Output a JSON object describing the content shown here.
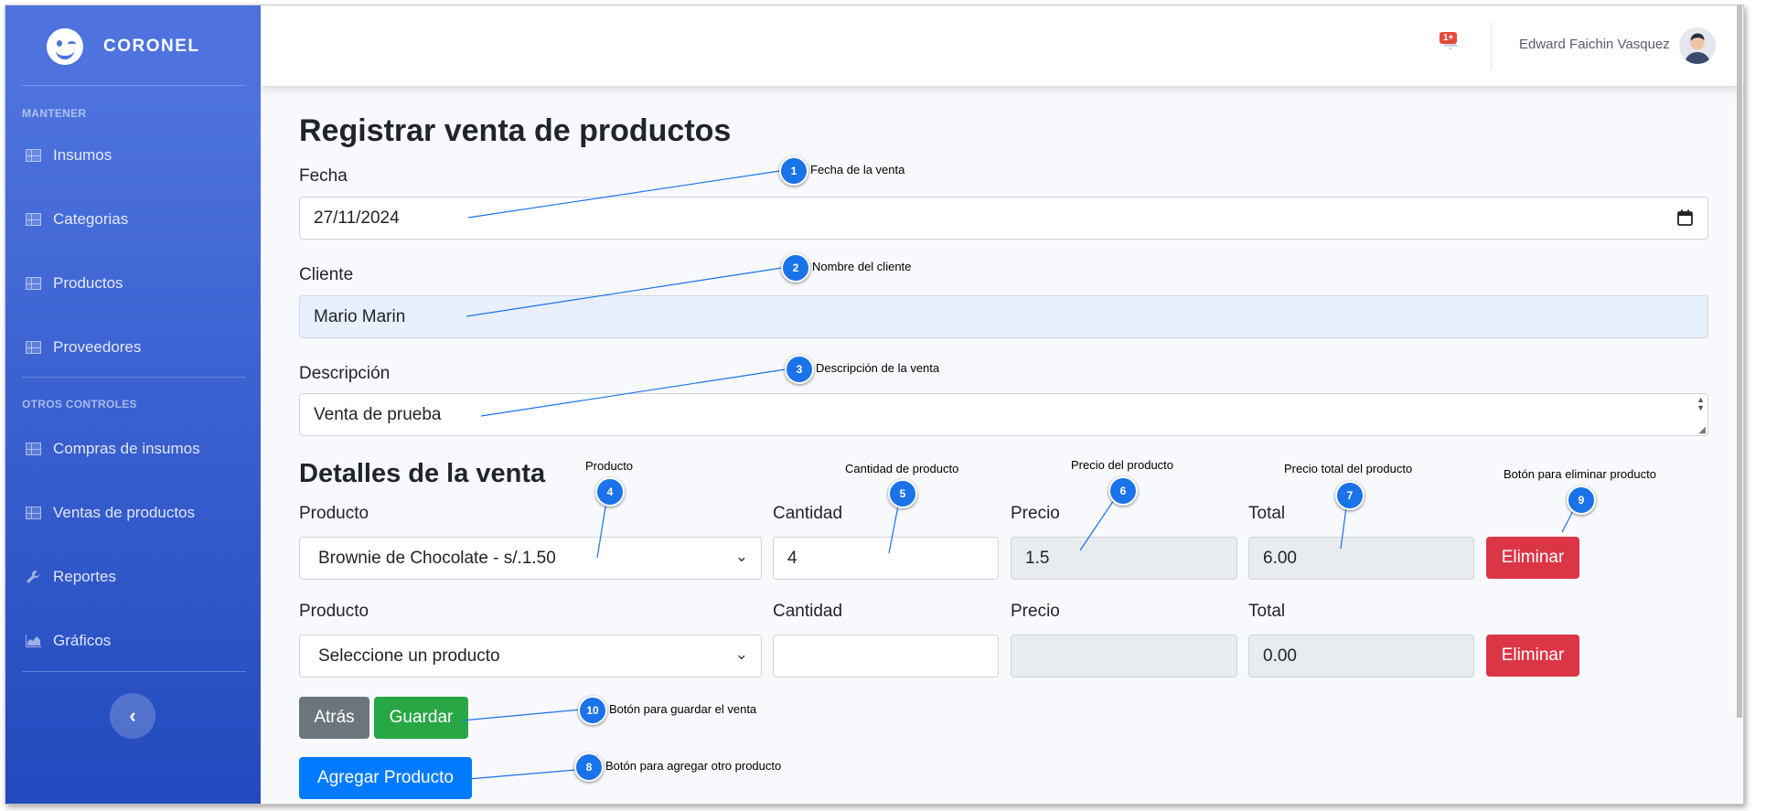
{
  "sidebar": {
    "brand": "CORONEL",
    "heading_maintain": "MANTENER",
    "heading_other": "OTROS CONTROLES",
    "items": [
      {
        "label": "Insumos"
      },
      {
        "label": "Categorias"
      },
      {
        "label": "Productos"
      },
      {
        "label": "Proveedores"
      },
      {
        "label": "Compras de insumos"
      },
      {
        "label": "Ventas de productos"
      },
      {
        "label": "Reportes",
        "icon": "wrench-icon"
      },
      {
        "label": "Gráficos",
        "icon": "chart-area-icon"
      }
    ],
    "toggle_glyph": "‹"
  },
  "topbar": {
    "alert_badge": "1+",
    "user_name": "Edward Faichin Vasquez"
  },
  "page": {
    "title": "Registrar venta de productos",
    "fecha_label": "Fecha",
    "fecha_value": "27/11/2024",
    "cliente_label": "Cliente",
    "cliente_value": "Mario Marin",
    "descripcion_label": "Descripción",
    "descripcion_value": "Venta de prueba",
    "details_title": "Detalles de la venta",
    "rows": [
      {
        "producto_label": "Producto",
        "producto_value": "Brownie de Chocolate - s/.1.50",
        "cantidad_label": "Cantidad",
        "cantidad_value": "4",
        "precio_label": "Precio",
        "precio_value": "1.5",
        "total_label": "Total",
        "total_value": "6.00",
        "delete_label": "Eliminar"
      },
      {
        "producto_label": "Producto",
        "producto_value": "Seleccione un producto",
        "cantidad_label": "Cantidad",
        "cantidad_value": "",
        "precio_label": "Precio",
        "precio_value": "",
        "total_label": "Total",
        "total_value": "0.00",
        "delete_label": "Eliminar"
      }
    ],
    "back_label": "Atrás",
    "save_label": "Guardar",
    "add_product_label": "Agregar Producto"
  },
  "annotations": [
    {
      "n": "1",
      "text": "Fecha de la venta"
    },
    {
      "n": "2",
      "text": "Nombre del cliente"
    },
    {
      "n": "3",
      "text": "Descripción de la venta"
    },
    {
      "n": "4",
      "text": "Producto"
    },
    {
      "n": "5",
      "text": "Cantidad de producto"
    },
    {
      "n": "6",
      "text": "Precio del producto"
    },
    {
      "n": "7",
      "text": "Precio total del producto"
    },
    {
      "n": "8",
      "text": "Botón para agregar otro producto"
    },
    {
      "n": "9",
      "text": "Botón para eliminar producto"
    },
    {
      "n": "10",
      "text": "Botón para guardar el venta"
    }
  ],
  "colors": {
    "sidebar_top": "#4e73df",
    "sidebar_bottom": "#224abe",
    "danger": "#dc3545",
    "success": "#28a745",
    "primary": "#007bff",
    "secondary": "#6c757d",
    "annotation_marker": "#1a73e8"
  }
}
